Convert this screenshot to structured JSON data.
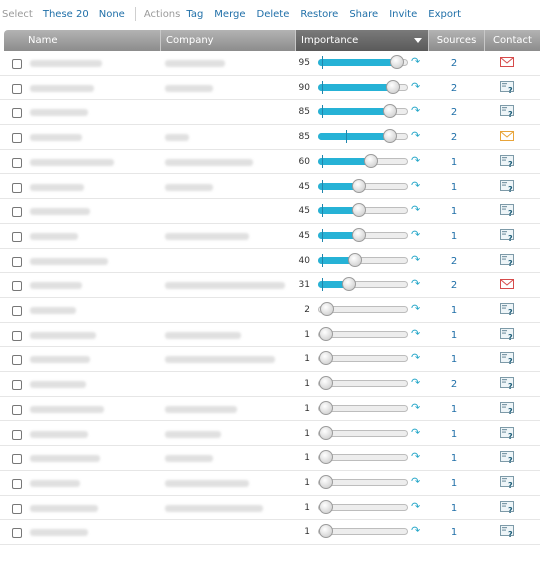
{
  "toolbar": {
    "select_label": "Select",
    "these_label": "These 20",
    "none_label": "None",
    "actions_label": "Actions",
    "actions": [
      "Tag",
      "Merge",
      "Delete",
      "Restore",
      "Share",
      "Invite",
      "Export"
    ]
  },
  "columns": {
    "name": "Name",
    "company": "Company",
    "importance": "Importance",
    "sources": "Sources",
    "contact": "Contact"
  },
  "colors": {
    "accent_link": "#1f6fa8",
    "slider_fill": "#26b2d6",
    "mail_red": "#d64b4b",
    "mail_orange": "#e8a43a"
  },
  "rows": [
    {
      "importance": "95",
      "sources": "2",
      "contact_icon": "mail-red-icon"
    },
    {
      "importance": "90",
      "sources": "2",
      "contact_icon": "vcard-question-icon"
    },
    {
      "importance": "85",
      "sources": "2",
      "contact_icon": "vcard-question-icon"
    },
    {
      "importance": "85",
      "sources": "2",
      "contact_icon": "mail-orange-icon"
    },
    {
      "importance": "60",
      "sources": "1",
      "contact_icon": "vcard-question-icon"
    },
    {
      "importance": "45",
      "sources": "1",
      "contact_icon": "vcard-question-icon"
    },
    {
      "importance": "45",
      "sources": "1",
      "contact_icon": "vcard-question-icon"
    },
    {
      "importance": "45",
      "sources": "1",
      "contact_icon": "vcard-question-icon"
    },
    {
      "importance": "40",
      "sources": "2",
      "contact_icon": "vcard-question-icon"
    },
    {
      "importance": "31",
      "sources": "2",
      "contact_icon": "mail-red-icon"
    },
    {
      "importance": "2",
      "sources": "1",
      "contact_icon": "vcard-question-icon"
    },
    {
      "importance": "1",
      "sources": "1",
      "contact_icon": "vcard-question-icon"
    },
    {
      "importance": "1",
      "sources": "1",
      "contact_icon": "vcard-question-icon"
    },
    {
      "importance": "1",
      "sources": "2",
      "contact_icon": "vcard-question-icon"
    },
    {
      "importance": "1",
      "sources": "1",
      "contact_icon": "vcard-question-icon"
    },
    {
      "importance": "1",
      "sources": "1",
      "contact_icon": "vcard-question-icon"
    },
    {
      "importance": "1",
      "sources": "1",
      "contact_icon": "vcard-question-icon"
    },
    {
      "importance": "1",
      "sources": "1",
      "contact_icon": "vcard-question-icon"
    },
    {
      "importance": "1",
      "sources": "1",
      "contact_icon": "vcard-question-icon"
    },
    {
      "importance": "1",
      "sources": "1",
      "contact_icon": "vcard-question-icon"
    }
  ]
}
